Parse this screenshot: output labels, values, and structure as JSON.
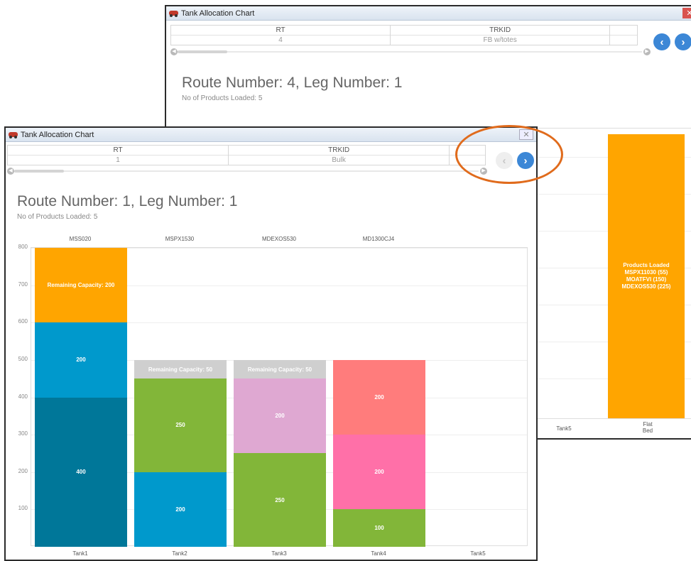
{
  "colors": {
    "orange": "#ffa500",
    "teal": "#0099cc",
    "dark_teal": "#007799",
    "green": "#82b639",
    "pink_light": "#dfa8d2",
    "salmon": "#ff7c7c",
    "pink": "#ff70a8",
    "remaining_grey": "#cfcfcf",
    "highlight": "#e06b1c",
    "nav_blue": "#3c87d6"
  },
  "back_window": {
    "title": "Tank Allocation Chart",
    "grid": {
      "columns": [
        "RT",
        "TRKID"
      ],
      "values": [
        "4",
        "FB w/totes"
      ]
    },
    "route_title": "Route Number: 4, Leg Number: 1",
    "products_loaded": "No of Products Loaded: 5",
    "x_labels": [
      "Tank5",
      "Flat\nBed"
    ],
    "flatbed_label": "Products Loaded\nMSPX11030 (55)\nMOATFVI (150)\nMDEXOS530 (225)"
  },
  "front_window": {
    "title": "Tank Allocation Chart",
    "grid": {
      "columns": [
        "RT",
        "TRKID"
      ],
      "values": [
        "1",
        "Bulk"
      ]
    },
    "route_title": "Route Number: 1, Leg Number: 1",
    "products_loaded": "No of Products Loaded: 5"
  },
  "chart_data": {
    "type": "bar",
    "stacked": true,
    "categories": [
      "Tank1",
      "Tank2",
      "Tank3",
      "Tank4",
      "Tank5"
    ],
    "top_labels": [
      "MSS020",
      "MSPX1530",
      "MDEXOS530",
      "MD1300CJ4",
      ""
    ],
    "ylim": [
      0,
      800
    ],
    "yticks": [
      100,
      200,
      300,
      400,
      500,
      600,
      700,
      800
    ],
    "stacks": [
      [
        {
          "value": 400,
          "label": "400",
          "color": "#007799"
        },
        {
          "value": 200,
          "label": "200",
          "color": "#0099cc"
        },
        {
          "value": 200,
          "label": "Remaining Capacity: 200",
          "color": "#ffa500"
        }
      ],
      [
        {
          "value": 200,
          "label": "200",
          "color": "#0099cc"
        },
        {
          "value": 250,
          "label": "250",
          "color": "#82b639"
        },
        {
          "value": 50,
          "label": "Remaining Capacity: 50",
          "color": "#cfcfcf"
        }
      ],
      [
        {
          "value": 250,
          "label": "250",
          "color": "#82b639"
        },
        {
          "value": 200,
          "label": "200",
          "color": "#dfa8d2"
        },
        {
          "value": 50,
          "label": "Remaining Capacity: 50",
          "color": "#cfcfcf"
        }
      ],
      [
        {
          "value": 100,
          "label": "100",
          "color": "#82b639"
        },
        {
          "value": 200,
          "label": "200",
          "color": "#ff70a8"
        },
        {
          "value": 200,
          "label": "200",
          "color": "#ff7c7c"
        }
      ],
      []
    ]
  }
}
